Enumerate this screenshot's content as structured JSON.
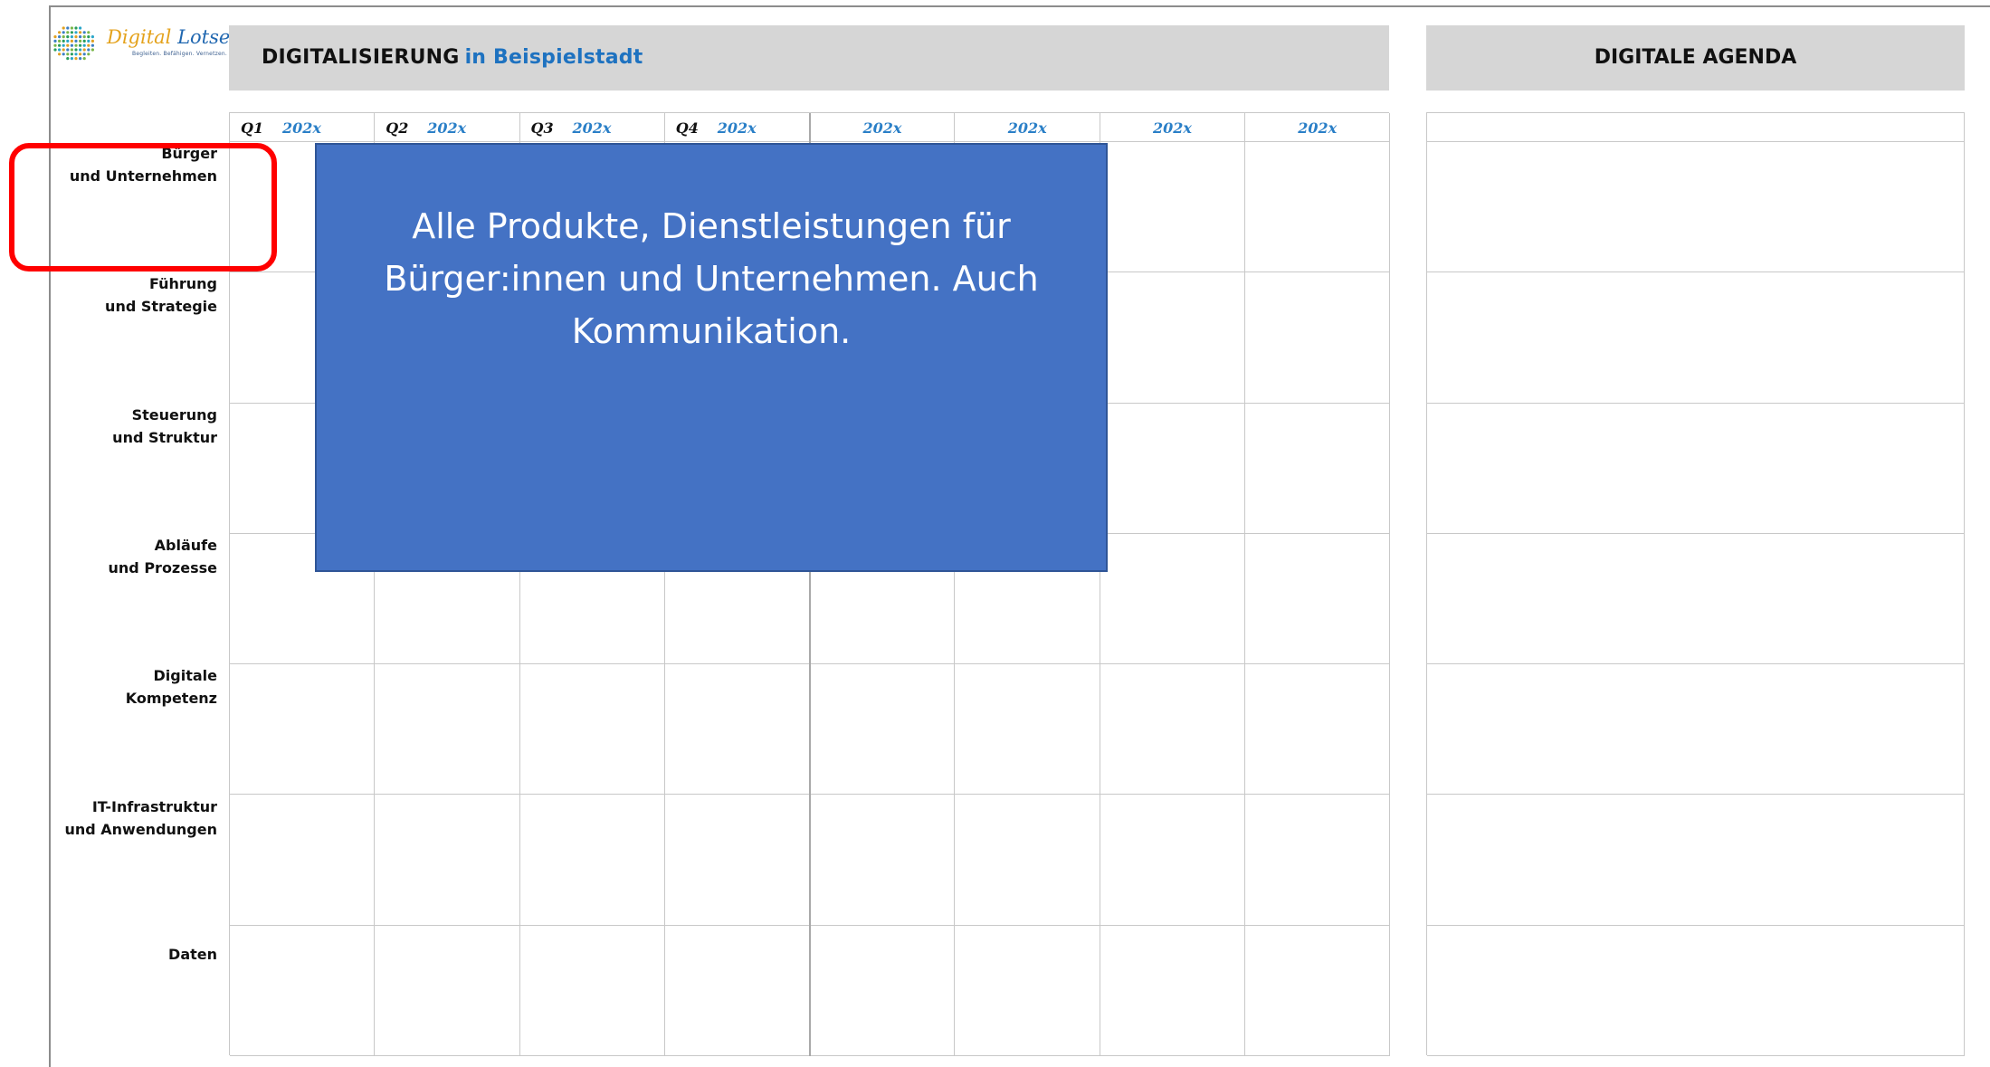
{
  "logo": {
    "word1": "Digital",
    "word2": "Lotsen",
    "tagline": "Begleiten. Befähigen. Vernetzen."
  },
  "header": {
    "title": "DIGITALISIERUNG",
    "city": "in Beispielstadt",
    "agenda_title": "DIGITALE AGENDA"
  },
  "columns": [
    {
      "q": "Q1",
      "year": "202x"
    },
    {
      "q": "Q2",
      "year": "202x"
    },
    {
      "q": "Q3",
      "year": "202x"
    },
    {
      "q": "Q4",
      "year": "202x"
    },
    {
      "q": "",
      "year": "202x"
    },
    {
      "q": "",
      "year": "202x"
    },
    {
      "q": "",
      "year": "202x"
    },
    {
      "q": "",
      "year": "202x"
    }
  ],
  "rows": [
    {
      "line1": "Bürger",
      "line2": "und Unternehmen"
    },
    {
      "line1": "Führung",
      "line2": "und Strategie"
    },
    {
      "line1": "Steuerung",
      "line2": "und Struktur"
    },
    {
      "line1": "Abläufe",
      "line2": "und Prozesse"
    },
    {
      "line1": "Digitale",
      "line2": "Kompetenz"
    },
    {
      "line1": "IT-Infrastruktur",
      "line2": "und Anwendungen"
    },
    {
      "line1": "Daten",
      "line2": ""
    }
  ],
  "callout": {
    "text": "Alle Produkte, Dienstleistungen für Bürger:innen und Unternehmen. Auch Kommunikation."
  },
  "colors": {
    "callout_fill": "#4472c4",
    "highlight": "#ff0000",
    "header_bar": "#d6d6d6",
    "accent_blue": "#1e72c0"
  }
}
